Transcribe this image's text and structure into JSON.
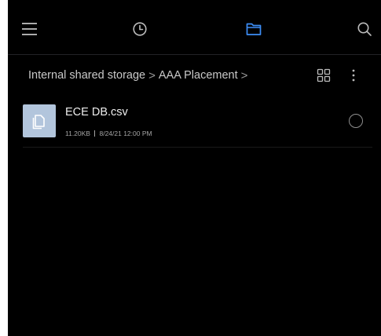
{
  "toolbar": {
    "menu_icon": "menu-icon",
    "recent_icon": "clock-icon",
    "files_icon": "folder-icon",
    "search_icon": "search-icon",
    "active_color": "#3d8ef7",
    "inactive_color": "#bdbdbd"
  },
  "breadcrumb": {
    "items": [
      "Internal shared storage",
      "AAA Placement"
    ],
    "separator": ">"
  },
  "actions": {
    "view_icon": "grid-view-icon",
    "more_icon": "more-vert-icon"
  },
  "files": [
    {
      "name": "ECE DB.csv",
      "size": "11.20KB",
      "modified": "8/24/21 12:00 PM",
      "icon": "document-icon",
      "selected": false
    }
  ]
}
